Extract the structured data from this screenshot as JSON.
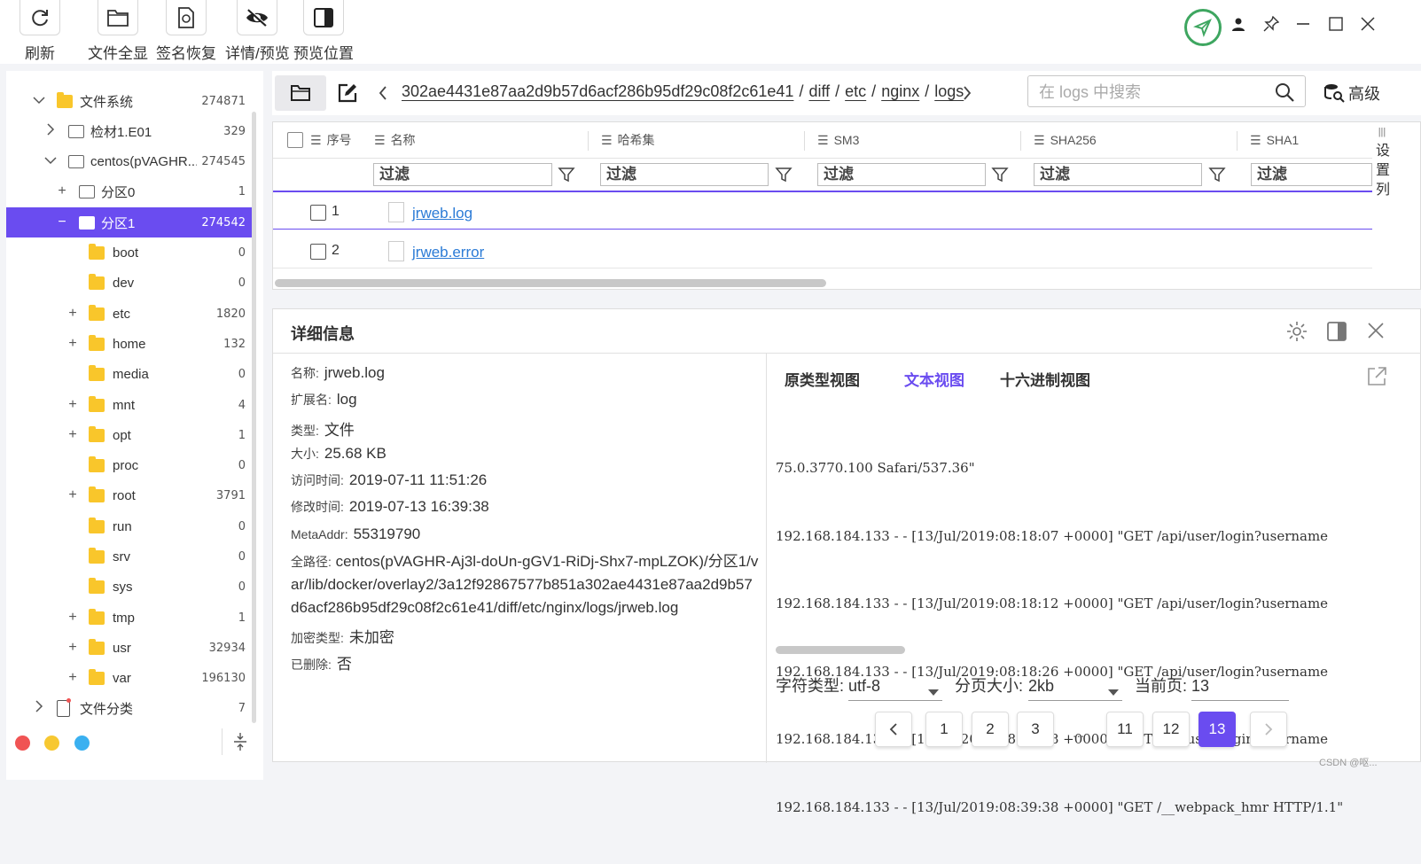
{
  "toolbar": {
    "buttons": [
      {
        "label": "刷新",
        "icon": "refresh-icon"
      },
      {
        "label": "文件全显",
        "icon": "folder-icon"
      },
      {
        "label": "签名恢复",
        "icon": "signature-restore-icon"
      },
      {
        "label": "详情/预览",
        "icon": "eye-off-icon"
      },
      {
        "label": "预览位置",
        "icon": "panel-right-icon"
      }
    ],
    "status_icon": "shield-check-icon",
    "window_controls": [
      "user-icon",
      "pin-icon",
      "minimize-icon",
      "maximize-icon",
      "close-icon"
    ]
  },
  "tree": {
    "items": [
      {
        "label": "文件系统",
        "count": "274871"
      },
      {
        "label": "检材1.E01",
        "count": "329"
      },
      {
        "label": "centos(pVAGHR...",
        "count": "274545"
      },
      {
        "label": "分区0",
        "count": "1"
      },
      {
        "label": "分区1",
        "count": "274542"
      },
      {
        "label": "boot",
        "count": "0"
      },
      {
        "label": "dev",
        "count": "0"
      },
      {
        "label": "etc",
        "count": "1820"
      },
      {
        "label": "home",
        "count": "132"
      },
      {
        "label": "media",
        "count": "0"
      },
      {
        "label": "mnt",
        "count": "4"
      },
      {
        "label": "opt",
        "count": "1"
      },
      {
        "label": "proc",
        "count": "0"
      },
      {
        "label": "root",
        "count": "3791"
      },
      {
        "label": "run",
        "count": "0"
      },
      {
        "label": "srv",
        "count": "0"
      },
      {
        "label": "sys",
        "count": "0"
      },
      {
        "label": "tmp",
        "count": "1"
      },
      {
        "label": "usr",
        "count": "32934"
      },
      {
        "label": "var",
        "count": "196130"
      },
      {
        "label": "文件分类",
        "count": "7"
      }
    ],
    "dot_colors": [
      "#f05454",
      "#f7c831",
      "#3ab0f0"
    ]
  },
  "pathbar": {
    "segments": [
      "302ae4431e87aa2d9b57d6acf286b95df29c08f2c61e41",
      "diff",
      "etc",
      "nginx",
      "logs"
    ],
    "search_placeholder": "在 logs 中搜索",
    "advanced_label": "高级"
  },
  "table": {
    "columns": [
      "序号",
      "名称",
      "哈希集",
      "SM3",
      "SHA256",
      "SHA1"
    ],
    "filter_placeholder": "过滤",
    "rows": [
      {
        "num": "1",
        "name": "jrweb.log"
      },
      {
        "num": "2",
        "name": "jrweb.error"
      }
    ],
    "side_label": "设置列"
  },
  "details": {
    "title": "详细信息",
    "fields": [
      {
        "key": "名称:",
        "value": "jrweb.log"
      },
      {
        "key": "扩展名:",
        "value": "log"
      },
      {
        "key": "类型:",
        "value": "文件"
      },
      {
        "key": "大小:",
        "value": "25.68 KB"
      },
      {
        "key": "访问时间:",
        "value": "2019-07-11 11:51:26"
      },
      {
        "key": "修改时间:",
        "value": "2019-07-13 16:39:38"
      },
      {
        "key": "MetaAddr:",
        "value": "55319790"
      }
    ],
    "full_path_key": "全路径:",
    "full_path_value": "centos(pVAGHR-Aj3l-doUn-gGV1-RiDj-Shx7-mpLZOK)/分区1/var/lib/docker/overlay2/3a12f92867577b851a302ae4431e87aa2d9b57d6acf286b95df29c08f2c61e41/diff/etc/nginx/logs/jrweb.log",
    "fields2": [
      {
        "key": "加密类型:",
        "value": "未加密"
      },
      {
        "key": "已删除:",
        "value": "否"
      }
    ],
    "view_tabs": [
      "原类型视图",
      "文本视图",
      "十六进制视图"
    ],
    "text_lines": [
      "75.0.3770.100 Safari/537.36\"",
      "192.168.184.133 - - [13/Jul/2019:08:18:07 +0000] \"GET /api/user/login?username",
      "192.168.184.133 - - [13/Jul/2019:08:18:12 +0000] \"GET /api/user/login?username",
      "192.168.184.133 - - [13/Jul/2019:08:18:26 +0000] \"GET /api/user/login?username",
      "192.168.184.133 - - [13/Jul/2019:08:18:38 +0000] \"GET /api/user/login?username",
      "192.168.184.133 - - [13/Jul/2019:08:39:38 +0000] \"GET /__webpack_hmr HTTP/1.1\""
    ],
    "charset_label": "字符类型:",
    "charset_value": "utf-8",
    "pagesize_label": "分页大小:",
    "pagesize_value": "2kb",
    "curpage_label": "当前页:",
    "curpage_value": "13",
    "pages": [
      "1",
      "2",
      "3",
      "...",
      "11",
      "12",
      "13"
    ]
  },
  "colors": {
    "accent": "#6a4cf0",
    "link": "#2b7bd6",
    "shield": "#3ea660"
  },
  "watermark": "CSDN @呕..."
}
